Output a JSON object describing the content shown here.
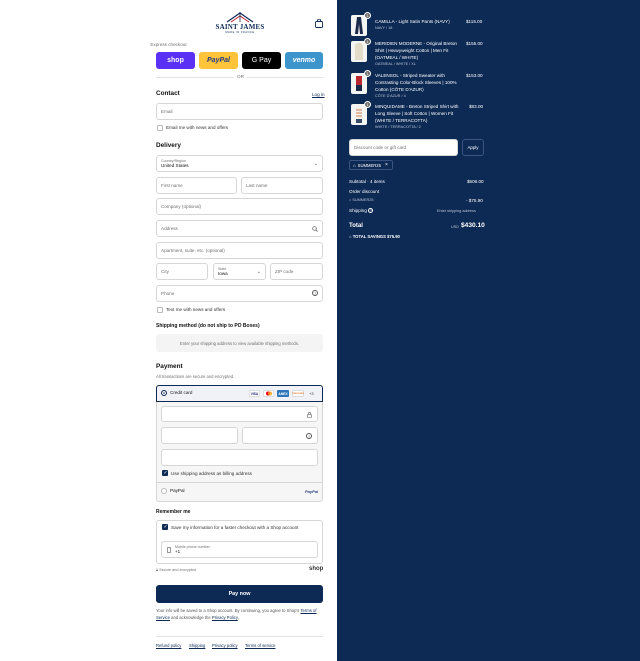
{
  "header": {
    "brand": "SAINT JAMES",
    "brand_sub": "MADE IN FRANCE",
    "bag_icon": "shopping-bag-icon"
  },
  "express": {
    "title": "Express checkout",
    "buttons": [
      {
        "label": "shop",
        "color": "#5a31f4"
      },
      {
        "label": "PayPal",
        "color": "#ffc439"
      },
      {
        "label": "G Pay",
        "color": "#000000"
      },
      {
        "label": "venmo",
        "color": "#3d95ce"
      }
    ],
    "or": "OR"
  },
  "contact": {
    "title": "Contact",
    "login": "Log in",
    "email_placeholder": "Email",
    "news_label": "Email me with news and offers"
  },
  "delivery": {
    "title": "Delivery",
    "country_label": "Country/Region",
    "country_value": "United States",
    "first_name": "First name",
    "last_name": "Last name",
    "company": "Company (optional)",
    "address": "Address",
    "apartment": "Apartment, suite, etc. (optional)",
    "city": "City",
    "state_label": "State",
    "state_value": "Iowa",
    "zip": "ZIP code",
    "phone": "Phone",
    "text_news": "Text me with news and offers"
  },
  "shipping": {
    "title": "Shipping method (do not ship to PO Boxes)",
    "message": "Enter your shipping address to view available shipping methods."
  },
  "payment": {
    "title": "Payment",
    "subtitle": "All transactions are secure and encrypted.",
    "credit_card": "Credit card",
    "card_brands": [
      "VISA",
      "MC",
      "AMEX",
      "DISCOVER"
    ],
    "more_cards": "+3",
    "billing_same": "Use shipping address as billing address",
    "paypal": "PayPal"
  },
  "remember": {
    "title": "Remember me",
    "save_info": "Save my information for a faster checkout with a Shop account",
    "mobile_label": "Mobile phone number",
    "mobile_value": "+1",
    "secure": "Secure and encrypted",
    "shop": "shop"
  },
  "pay_now": "Pay now",
  "legal": {
    "text1": "Your info will be saved to a Shop account. By continuing, you agree to Shop's",
    "terms": "Terms of Service",
    "and": "and acknowledge the",
    "privacy": "Privacy Policy",
    "period": "."
  },
  "footer_links": [
    "Refund policy",
    "Shipping",
    "Privacy policy",
    "Terms of service"
  ],
  "order": {
    "items": [
      {
        "qty": "1",
        "title": [
          "CAMILLA - Light Satin Pants (NAVY)"
        ],
        "variant": "NAVY / 18",
        "price": "$115.00"
      },
      {
        "qty": "1",
        "title": [
          "MERIDIEN MODERNE - Original Breton",
          "Shirt | Heavyweight Cotton | Men Fit",
          "(OATMEAL / WHITE)"
        ],
        "variant": "OATMEAL / WHITE / XL",
        "price": "$155.00"
      },
      {
        "qty": "1",
        "title": [
          "VALENSOL - Striped Sweater with",
          "Contrasting Color-Block Sleeves | 100%",
          "Cotton (CÔTE D'AZUR)"
        ],
        "variant": "CÔTE D'AZUR / 4",
        "price": "$153.00"
      },
      {
        "qty": "1",
        "title": [
          "MINQUIDAME - Breton Striped Shirt with",
          "Long Sleeve | Soft Cotton | Women Fit",
          "(WHITE / TERRACOTTA)"
        ],
        "variant": "WHITE / TERRACOTTA / 2",
        "price": "$83.00"
      }
    ],
    "discount_placeholder": "Discount code or gift card",
    "apply": "Apply",
    "code": "SUMMER25",
    "subtotal_label": "Subtotal · 4 items",
    "subtotal": "$506.00",
    "order_discount": "Order discount",
    "discount_code": "SUMMER25",
    "discount_value": "- $75.90",
    "shipping_label": "Shipping",
    "shipping_value": "Enter shipping address",
    "total_label": "Total",
    "currency": "USD",
    "total": "$430.10",
    "savings_label": "TOTAL SAVINGS",
    "savings": "$75.90"
  }
}
